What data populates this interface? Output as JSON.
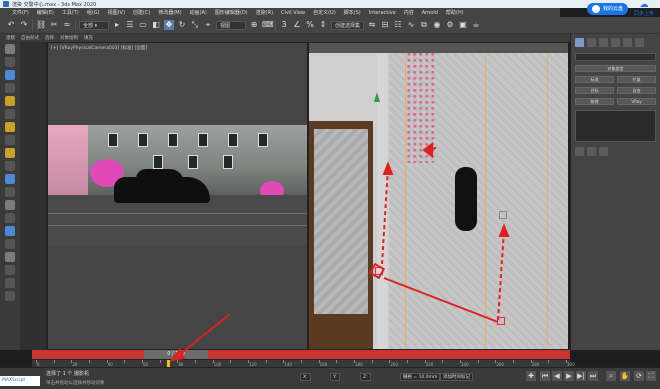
{
  "window": {
    "title": "渲染 交警中心.max - 3ds Max 2020",
    "controls": [
      "–",
      "□",
      "×"
    ]
  },
  "overlay_widgets": {
    "cloud_label": "我的云盘",
    "cloud_sync": "同步上传"
  },
  "menu": {
    "items": [
      "文件(F)",
      "编辑(E)",
      "工具(T)",
      "组(G)",
      "视图(V)",
      "创建(C)",
      "修改器(M)",
      "动画(A)",
      "图形编辑器(D)",
      "渲染(R)",
      "Civil View",
      "自定义(U)",
      "脚本(S)",
      "Interactive",
      "内容",
      "Arnold",
      "帮助(H)"
    ]
  },
  "toolbar": {
    "selection_set_dropdown": "创建选择集",
    "view_dropdown": "视图"
  },
  "ribbon": {
    "items": [
      "建模",
      "自由形式",
      "选择",
      "对象绘制",
      "填充"
    ]
  },
  "viewport_left": {
    "label": "[+] [VRayPhysicalCamera003] [标准] [边面]"
  },
  "viewport_right": {
    "label": ""
  },
  "command_panel": {
    "object_type_label": "对象类型",
    "buttons": [
      "标准",
      "扩展",
      "目标",
      "自由",
      "物理",
      "VRay"
    ]
  },
  "timeline": {
    "frame_display": "0 / 100",
    "ticks": [
      0,
      10,
      20,
      30,
      40,
      50,
      60,
      70,
      80,
      90,
      100,
      110,
      120,
      130,
      140,
      150,
      160,
      170,
      180,
      190,
      200,
      210,
      220,
      230,
      240,
      250,
      260,
      270,
      280,
      290,
      300
    ]
  },
  "status": {
    "selected": "选择了 1 个 摄影机",
    "hint": "单击并拖动以选择并移动对象",
    "x_label": "X:",
    "x_value": "",
    "y_label": "Y:",
    "y_value": "",
    "z_label": "Z:",
    "z_value": "",
    "grid": "栅格 = 10.0mm",
    "add_time_tag": "添加时间标记",
    "maxscript": "MAXScript"
  },
  "colors": {
    "accent": "#1a73e8",
    "annotation_red": "#e02020",
    "timebar_red": "#c8342e"
  }
}
